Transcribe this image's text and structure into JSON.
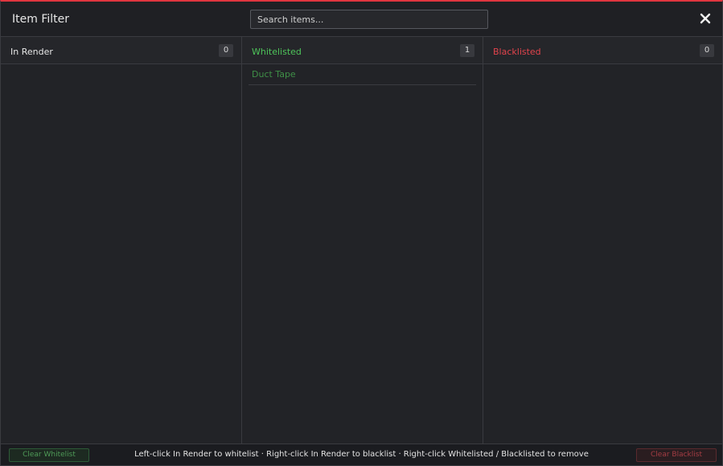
{
  "window": {
    "title": "Item Filter",
    "accent_color": "#e0353f"
  },
  "search": {
    "placeholder": "Search items...",
    "value": ""
  },
  "close_icon": "close-icon",
  "columns": {
    "in_render": {
      "title": "In Render",
      "count": "0",
      "color": "#e6e6e6",
      "items": []
    },
    "whitelisted": {
      "title": "Whitelisted",
      "count": "1",
      "color": "#4ec45a",
      "item_color": "#3f8f47",
      "items": [
        "Duct Tape"
      ]
    },
    "blacklisted": {
      "title": "Blacklisted",
      "count": "0",
      "color": "#e2434c",
      "items": []
    }
  },
  "footer": {
    "clear_whitelist_label": "Clear Whitelist",
    "clear_whitelist_color": "#4e9a57",
    "clear_blacklist_label": "Clear Blacklist",
    "clear_blacklist_color": "#a33c43",
    "hint": "Left-click In Render to whitelist  ·  Right-click In Render to blacklist  ·  Right-click Whitelisted / Blacklisted to remove"
  }
}
